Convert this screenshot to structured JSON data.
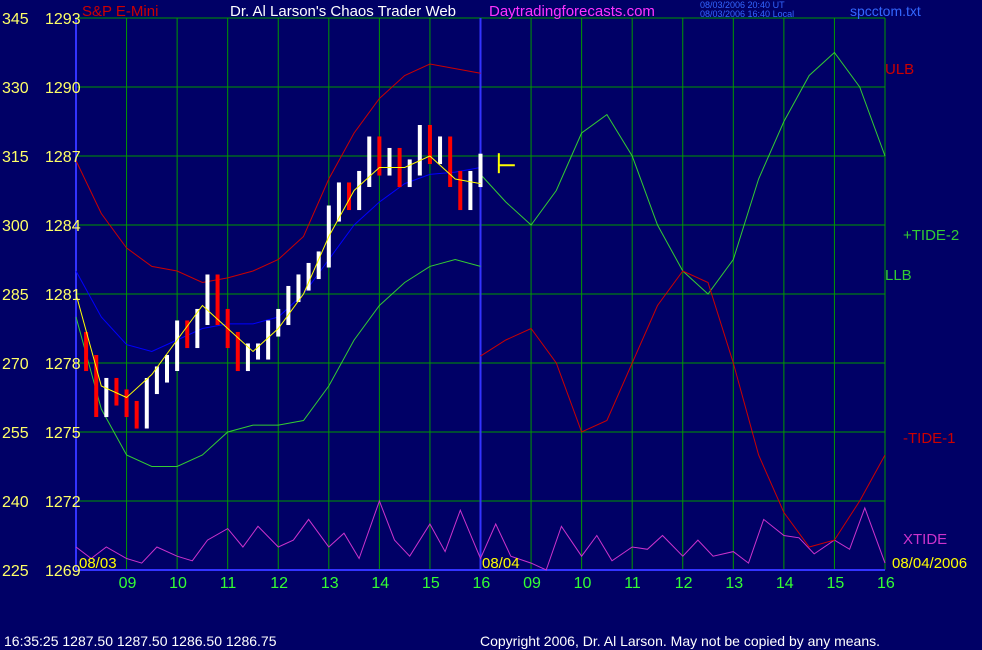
{
  "header": {
    "symbol": "S&P E-Mini",
    "title": "Dr. Al Larson's Chaos Trader Web",
    "site": "Daytradingforecasts.com",
    "date_line1": "08/03/2006 20:40 UT",
    "date_line2": "08/03/2006 16:40 Local",
    "file": "spcctom.txt"
  },
  "footer": {
    "quote": "16:35:25   1287.50  1287.50  1286.50  1286.75",
    "copyright": "Copyright 2006, Dr. Al Larson. May not be copied by any means."
  },
  "colors": {
    "background": "#000066",
    "grid": "#009900",
    "axis": "#3333ff",
    "price": "#ffffff",
    "price_down": "#ff0000",
    "ma_fast": "#ffff00",
    "ma_slow": "#0000ff",
    "ulb": "#cc0000",
    "llb": "#33cc33",
    "tide_plus": "#33cc33",
    "tide_minus": "#cc0000",
    "xtide": "#cc33cc",
    "cursor": "#ffff00"
  },
  "chart_data": {
    "type": "line",
    "title": "Dr. Al Larson's Chaos Trader Web",
    "y_left_ticks": [
      345,
      330,
      315,
      300,
      285,
      270,
      255,
      240,
      225
    ],
    "y_price_ticks": [
      1293,
      1290,
      1287,
      1284,
      1281,
      1278,
      1275,
      1272,
      1269
    ],
    "price_range": [
      1269,
      1293
    ],
    "x_ticks": [
      "09",
      "10",
      "11",
      "12",
      "13",
      "14",
      "15",
      "16",
      "09",
      "10",
      "11",
      "12",
      "13",
      "14",
      "15",
      "16"
    ],
    "x_range_hours": [
      8.0,
      24.0
    ],
    "date_labels": [
      "08/03",
      "08/04",
      "08/04/2006"
    ],
    "series_labels": {
      "ulb": "ULB",
      "llb": "LLB",
      "tide_plus": "+TIDE-2",
      "tide_minus": "-TIDE-1",
      "xtide": "XTIDE"
    },
    "price": {
      "x": [
        8.0,
        8.2,
        8.4,
        8.6,
        8.8,
        9.0,
        9.2,
        9.4,
        9.6,
        9.8,
        10.0,
        10.2,
        10.4,
        10.6,
        10.8,
        11.0,
        11.2,
        11.4,
        11.6,
        11.8,
        12.0,
        12.2,
        12.4,
        12.6,
        12.8,
        13.0,
        13.2,
        13.4,
        13.6,
        13.8,
        14.0,
        14.2,
        14.4,
        14.6,
        14.8,
        15.0,
        15.2,
        15.4,
        15.6,
        15.8,
        16.0
      ],
      "y": [
        1279.0,
        1278.0,
        1276.0,
        1277.0,
        1276.5,
        1276.0,
        1275.5,
        1277.0,
        1277.5,
        1278.0,
        1279.5,
        1279.0,
        1280.0,
        1281.5,
        1280.0,
        1279.0,
        1278.0,
        1278.5,
        1278.5,
        1279.5,
        1280.0,
        1281.0,
        1281.5,
        1282.0,
        1282.5,
        1284.5,
        1285.5,
        1285.0,
        1286.0,
        1287.5,
        1286.5,
        1287.0,
        1286.0,
        1286.5,
        1288.0,
        1287.0,
        1287.5,
        1286.0,
        1285.0,
        1286.0,
        1286.75
      ]
    },
    "ma_fast": {
      "x": [
        8.0,
        8.5,
        9.0,
        9.5,
        10.0,
        10.5,
        11.0,
        11.5,
        12.0,
        12.5,
        13.0,
        13.5,
        14.0,
        14.5,
        15.0,
        15.5,
        16.0
      ],
      "y": [
        1281.0,
        1277.0,
        1276.5,
        1277.5,
        1279.0,
        1280.5,
        1279.5,
        1278.5,
        1279.5,
        1281.0,
        1283.5,
        1285.5,
        1286.5,
        1286.5,
        1287.0,
        1286.0,
        1285.8
      ]
    },
    "ma_slow": {
      "x": [
        8.0,
        8.5,
        9.0,
        9.5,
        10.0,
        10.5,
        11.0,
        11.5,
        12.0,
        12.5,
        13.0,
        13.5,
        14.0,
        14.5,
        15.0,
        15.5,
        16.0
      ],
      "y": [
        1282.0,
        1280.0,
        1278.8,
        1278.5,
        1279.0,
        1279.5,
        1279.7,
        1279.7,
        1280.0,
        1281.0,
        1282.5,
        1284.0,
        1285.0,
        1285.8,
        1286.2,
        1286.3,
        1286.5
      ]
    },
    "ulb": {
      "x": [
        8.0,
        8.5,
        9.0,
        9.5,
        10.0,
        10.5,
        11.0,
        11.5,
        12.0,
        12.5,
        13.0,
        13.5,
        14.0,
        14.5,
        15.0,
        15.5,
        16.0
      ],
      "y": [
        1286.8,
        1284.5,
        1283.0,
        1282.2,
        1282.0,
        1281.5,
        1281.7,
        1282.0,
        1282.5,
        1283.5,
        1286.0,
        1288.0,
        1289.5,
        1290.5,
        1291.0,
        1290.8,
        1290.6
      ]
    },
    "llb": {
      "x": [
        8.0,
        8.5,
        9.0,
        9.5,
        10.0,
        10.5,
        11.0,
        11.5,
        12.0,
        12.5,
        13.0,
        13.5,
        14.0,
        14.5,
        15.0,
        15.5,
        16.0
      ],
      "y": [
        1280.0,
        1276.0,
        1274.0,
        1273.5,
        1273.5,
        1274.0,
        1275.0,
        1275.3,
        1275.3,
        1275.5,
        1277.0,
        1279.0,
        1280.5,
        1281.5,
        1282.2,
        1282.5,
        1282.2
      ]
    },
    "xtide": {
      "x": [
        8.0,
        8.3,
        8.6,
        9.0,
        9.3,
        9.6,
        10.0,
        10.3,
        10.6,
        11.0,
        11.3,
        11.6,
        12.0,
        12.3,
        12.6,
        13.0,
        13.3,
        13.6,
        14.0,
        14.3,
        14.6,
        15.0,
        15.3,
        15.6,
        16.0,
        16.3,
        16.6,
        17.0,
        17.3,
        17.6,
        18.0,
        18.3,
        18.6,
        19.0,
        19.3,
        19.6,
        20.0,
        20.3,
        20.6,
        21.0,
        21.3,
        21.6,
        22.0,
        22.3,
        22.6,
        23.0,
        23.3,
        23.6,
        24.0
      ],
      "y": [
        1270.0,
        1269.5,
        1270.0,
        1269.5,
        1269.3,
        1270.0,
        1269.6,
        1269.4,
        1270.3,
        1270.8,
        1270.0,
        1270.9,
        1270.0,
        1270.3,
        1271.2,
        1270.0,
        1270.6,
        1269.5,
        1272.0,
        1270.3,
        1269.6,
        1271.0,
        1269.8,
        1271.6,
        1269.5,
        1271.0,
        1269.6,
        1269.3,
        1269.0,
        1270.9,
        1269.6,
        1270.5,
        1269.4,
        1270.0,
        1269.9,
        1270.5,
        1269.6,
        1270.3,
        1269.6,
        1269.8,
        1269.3,
        1271.2,
        1270.5,
        1270.4,
        1269.7,
        1270.3,
        1269.9,
        1271.7,
        1269.3
      ]
    },
    "ulb_forecast": {
      "x": [
        16.0,
        16.5,
        17.0,
        17.5,
        18.0,
        18.5,
        19.0,
        19.5,
        20.0,
        20.5,
        21.0,
        21.5,
        22.0,
        22.5,
        23.0,
        23.5,
        24.0
      ],
      "y": [
        1286.2,
        1285.0,
        1284.0,
        1285.5,
        1288.0,
        1288.8,
        1287.0,
        1284.0,
        1282.0,
        1281.0,
        1282.5,
        1286.0,
        1288.5,
        1290.5,
        1291.5,
        1290.0,
        1287.0
      ]
    },
    "llb_forecast": {
      "x": [
        16.0,
        16.5,
        17.0,
        17.5,
        18.0,
        18.5,
        19.0,
        19.5,
        20.0,
        20.5,
        21.0,
        21.5,
        22.0,
        22.5,
        23.0,
        23.5,
        24.0
      ],
      "y": [
        1278.3,
        1279.0,
        1279.5,
        1278.0,
        1275.0,
        1275.5,
        1278.0,
        1280.5,
        1282.0,
        1281.5,
        1278.0,
        1274.0,
        1271.5,
        1270.0,
        1270.3,
        1272.0,
        1274.0
      ]
    }
  }
}
